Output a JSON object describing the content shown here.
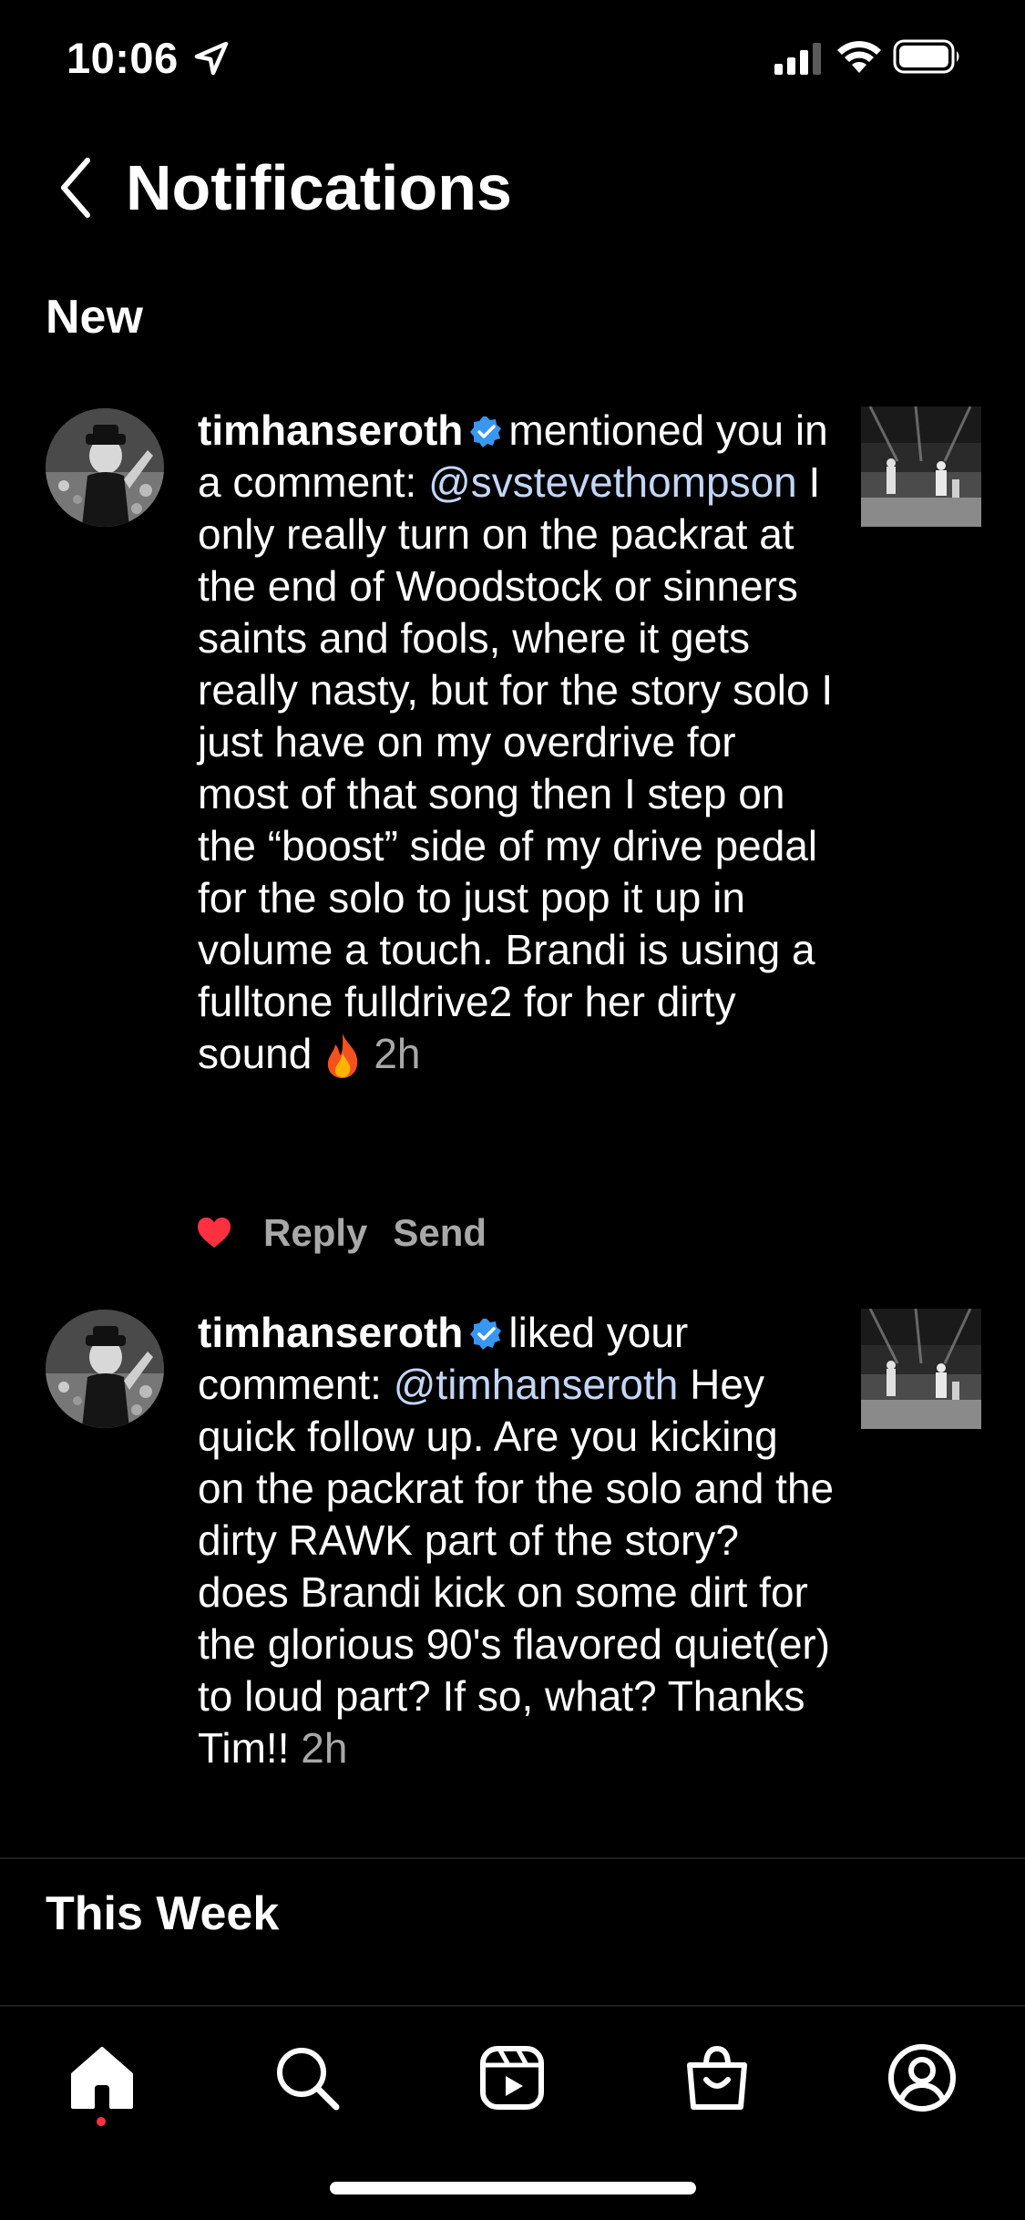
{
  "status_bar": {
    "time": "10:06"
  },
  "header": {
    "title": "Notifications"
  },
  "sections": {
    "new": "New",
    "this_week": "This Week"
  },
  "notifications": [
    {
      "username": "timhanseroth",
      "verified": true,
      "action": "mentioned you in a comment:",
      "mention": "@svstevethompson",
      "comment": "I only really turn on the packrat at the end of Woodstock or sinners saints and fools, where it gets really nasty, but for the story solo I just have on my overdrive for most of that song then I step on the “boost” side of my drive pedal for the solo to just pop it up in volume a touch. Brandi is using a fulltone fulldrive2 for her dirty sound",
      "time": "2h",
      "actions": {
        "reply": "Reply",
        "send": "Send"
      }
    },
    {
      "username": "timhanseroth",
      "verified": true,
      "action": "liked your comment:",
      "mention": "@timhanseroth",
      "comment": "Hey quick follow up.  Are you kicking on the packrat for the solo and the dirty RAWK part of the story?  does Brandi kick on some dirt for the glorious 90's flavored quiet(er) to loud part? If so, what?  Thanks Tim!!",
      "time": "2h"
    }
  ],
  "tab_bar": {
    "tabs": [
      "home-icon",
      "search-icon",
      "reels-icon",
      "shop-icon",
      "profile-icon"
    ],
    "active": "home-icon",
    "accent": "#ff3040"
  },
  "colors": {
    "background": "#000000",
    "mention": "#c4d6f5",
    "verified": "#3897f0",
    "secondary_text": "#a8a8a8",
    "like": "#ff3040"
  }
}
